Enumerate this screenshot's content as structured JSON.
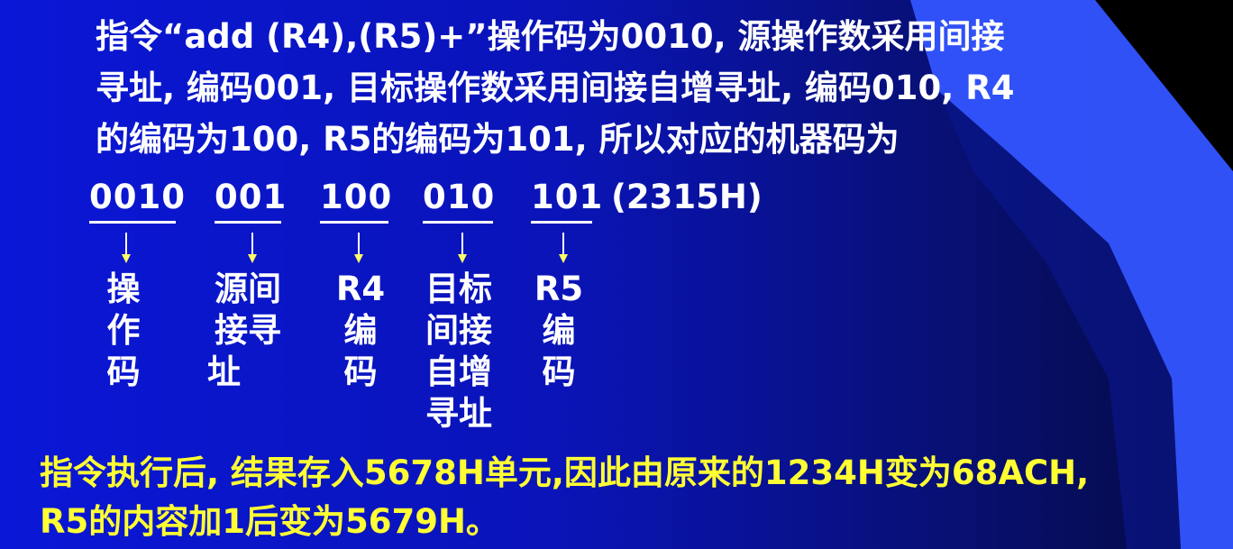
{
  "paragraph": {
    "line1": "指令“add (R4),(R5)+”操作码为0010, 源操作数采用间接",
    "line2": "寻址, 编码001, 目标操作数采用间接自增寻址, 编码010, R4",
    "line3": "的编码为100, R5的编码为101, 所以对应的机器码为"
  },
  "machine_code": {
    "fields": [
      {
        "bits": "0010",
        "label": [
          "操",
          "作",
          "码"
        ]
      },
      {
        "bits": "001",
        "label": [
          "源间",
          "接寻",
          "址"
        ]
      },
      {
        "bits": "100",
        "label": [
          "R4",
          "编",
          "码"
        ]
      },
      {
        "bits": "010",
        "label": [
          "目标",
          "间接",
          "自增",
          "寻址"
        ]
      },
      {
        "bits": "101",
        "label": [
          "R5",
          "编",
          "码"
        ]
      }
    ],
    "hex": "(2315H)"
  },
  "result": {
    "line1": "指令执行后, 结果存入5678H单元,因此由原来的1234H变为68ACH,",
    "line2": "R5的内容加1后变为5679H。"
  },
  "colors": {
    "background": "#0a17d6",
    "text": "#ffffff",
    "highlight": "#ffff33",
    "decor": "#3355ff"
  }
}
